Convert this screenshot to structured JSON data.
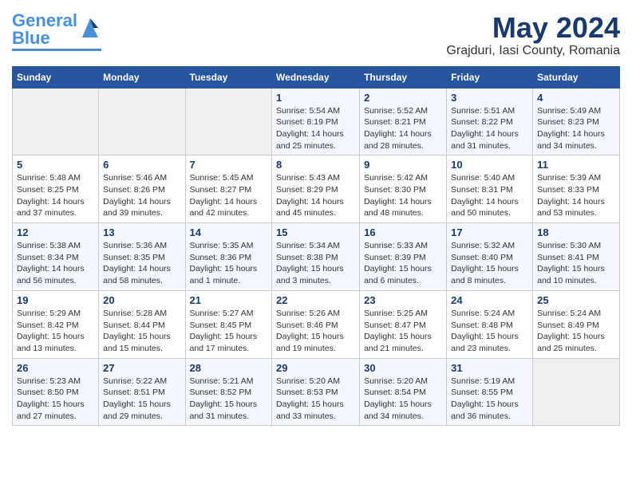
{
  "header": {
    "logo_general": "General",
    "logo_blue": "Blue",
    "month_title": "May 2024",
    "location": "Grajduri, Iasi County, Romania"
  },
  "days_of_week": [
    "Sunday",
    "Monday",
    "Tuesday",
    "Wednesday",
    "Thursday",
    "Friday",
    "Saturday"
  ],
  "weeks": [
    [
      {
        "day": "",
        "info": ""
      },
      {
        "day": "",
        "info": ""
      },
      {
        "day": "",
        "info": ""
      },
      {
        "day": "1",
        "info": "Sunrise: 5:54 AM\nSunset: 8:19 PM\nDaylight: 14 hours\nand 25 minutes."
      },
      {
        "day": "2",
        "info": "Sunrise: 5:52 AM\nSunset: 8:21 PM\nDaylight: 14 hours\nand 28 minutes."
      },
      {
        "day": "3",
        "info": "Sunrise: 5:51 AM\nSunset: 8:22 PM\nDaylight: 14 hours\nand 31 minutes."
      },
      {
        "day": "4",
        "info": "Sunrise: 5:49 AM\nSunset: 8:23 PM\nDaylight: 14 hours\nand 34 minutes."
      }
    ],
    [
      {
        "day": "5",
        "info": "Sunrise: 5:48 AM\nSunset: 8:25 PM\nDaylight: 14 hours\nand 37 minutes."
      },
      {
        "day": "6",
        "info": "Sunrise: 5:46 AM\nSunset: 8:26 PM\nDaylight: 14 hours\nand 39 minutes."
      },
      {
        "day": "7",
        "info": "Sunrise: 5:45 AM\nSunset: 8:27 PM\nDaylight: 14 hours\nand 42 minutes."
      },
      {
        "day": "8",
        "info": "Sunrise: 5:43 AM\nSunset: 8:29 PM\nDaylight: 14 hours\nand 45 minutes."
      },
      {
        "day": "9",
        "info": "Sunrise: 5:42 AM\nSunset: 8:30 PM\nDaylight: 14 hours\nand 48 minutes."
      },
      {
        "day": "10",
        "info": "Sunrise: 5:40 AM\nSunset: 8:31 PM\nDaylight: 14 hours\nand 50 minutes."
      },
      {
        "day": "11",
        "info": "Sunrise: 5:39 AM\nSunset: 8:33 PM\nDaylight: 14 hours\nand 53 minutes."
      }
    ],
    [
      {
        "day": "12",
        "info": "Sunrise: 5:38 AM\nSunset: 8:34 PM\nDaylight: 14 hours\nand 56 minutes."
      },
      {
        "day": "13",
        "info": "Sunrise: 5:36 AM\nSunset: 8:35 PM\nDaylight: 14 hours\nand 58 minutes."
      },
      {
        "day": "14",
        "info": "Sunrise: 5:35 AM\nSunset: 8:36 PM\nDaylight: 15 hours\nand 1 minute."
      },
      {
        "day": "15",
        "info": "Sunrise: 5:34 AM\nSunset: 8:38 PM\nDaylight: 15 hours\nand 3 minutes."
      },
      {
        "day": "16",
        "info": "Sunrise: 5:33 AM\nSunset: 8:39 PM\nDaylight: 15 hours\nand 6 minutes."
      },
      {
        "day": "17",
        "info": "Sunrise: 5:32 AM\nSunset: 8:40 PM\nDaylight: 15 hours\nand 8 minutes."
      },
      {
        "day": "18",
        "info": "Sunrise: 5:30 AM\nSunset: 8:41 PM\nDaylight: 15 hours\nand 10 minutes."
      }
    ],
    [
      {
        "day": "19",
        "info": "Sunrise: 5:29 AM\nSunset: 8:42 PM\nDaylight: 15 hours\nand 13 minutes."
      },
      {
        "day": "20",
        "info": "Sunrise: 5:28 AM\nSunset: 8:44 PM\nDaylight: 15 hours\nand 15 minutes."
      },
      {
        "day": "21",
        "info": "Sunrise: 5:27 AM\nSunset: 8:45 PM\nDaylight: 15 hours\nand 17 minutes."
      },
      {
        "day": "22",
        "info": "Sunrise: 5:26 AM\nSunset: 8:46 PM\nDaylight: 15 hours\nand 19 minutes."
      },
      {
        "day": "23",
        "info": "Sunrise: 5:25 AM\nSunset: 8:47 PM\nDaylight: 15 hours\nand 21 minutes."
      },
      {
        "day": "24",
        "info": "Sunrise: 5:24 AM\nSunset: 8:48 PM\nDaylight: 15 hours\nand 23 minutes."
      },
      {
        "day": "25",
        "info": "Sunrise: 5:24 AM\nSunset: 8:49 PM\nDaylight: 15 hours\nand 25 minutes."
      }
    ],
    [
      {
        "day": "26",
        "info": "Sunrise: 5:23 AM\nSunset: 8:50 PM\nDaylight: 15 hours\nand 27 minutes."
      },
      {
        "day": "27",
        "info": "Sunrise: 5:22 AM\nSunset: 8:51 PM\nDaylight: 15 hours\nand 29 minutes."
      },
      {
        "day": "28",
        "info": "Sunrise: 5:21 AM\nSunset: 8:52 PM\nDaylight: 15 hours\nand 31 minutes."
      },
      {
        "day": "29",
        "info": "Sunrise: 5:20 AM\nSunset: 8:53 PM\nDaylight: 15 hours\nand 33 minutes."
      },
      {
        "day": "30",
        "info": "Sunrise: 5:20 AM\nSunset: 8:54 PM\nDaylight: 15 hours\nand 34 minutes."
      },
      {
        "day": "31",
        "info": "Sunrise: 5:19 AM\nSunset: 8:55 PM\nDaylight: 15 hours\nand 36 minutes."
      },
      {
        "day": "",
        "info": ""
      }
    ]
  ]
}
